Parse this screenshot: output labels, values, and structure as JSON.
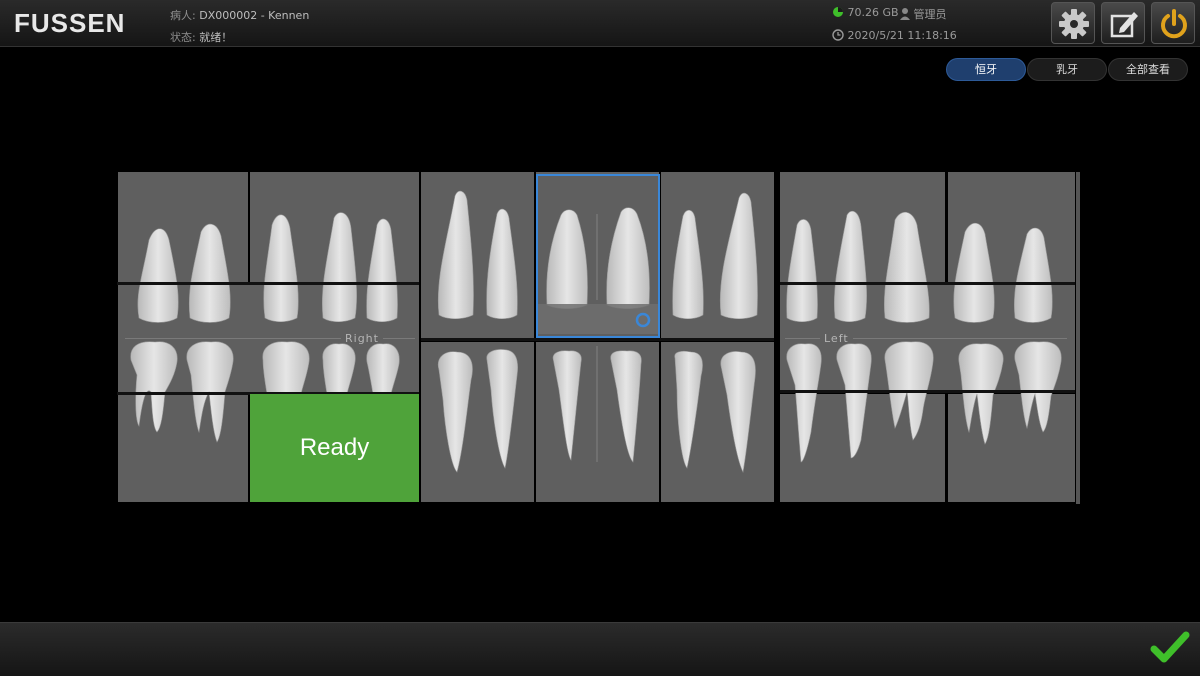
{
  "header": {
    "logo": "FUSSEN",
    "patient_label": "病人:",
    "patient_value": "DX000002 - Kennen",
    "status_label": "状态:",
    "status_value": "就绪！",
    "disk": "70.26 GB",
    "user": "管理员",
    "datetime": "2020/5/21 11:18:16"
  },
  "tabs": [
    {
      "label": "恒牙",
      "active": true
    },
    {
      "label": "乳牙",
      "active": false
    },
    {
      "label": "全部查看",
      "active": false
    }
  ],
  "chart": {
    "right_label": "Right",
    "left_label": "Left",
    "ready_label": "Ready"
  },
  "toolbar_icons": [
    "gear-icon",
    "edit-icon",
    "power-icon"
  ],
  "colors": {
    "accent": "#2d5a98",
    "ready": "#4fa33a",
    "confirm": "#3fbf2a",
    "power": "#e0a21c"
  }
}
